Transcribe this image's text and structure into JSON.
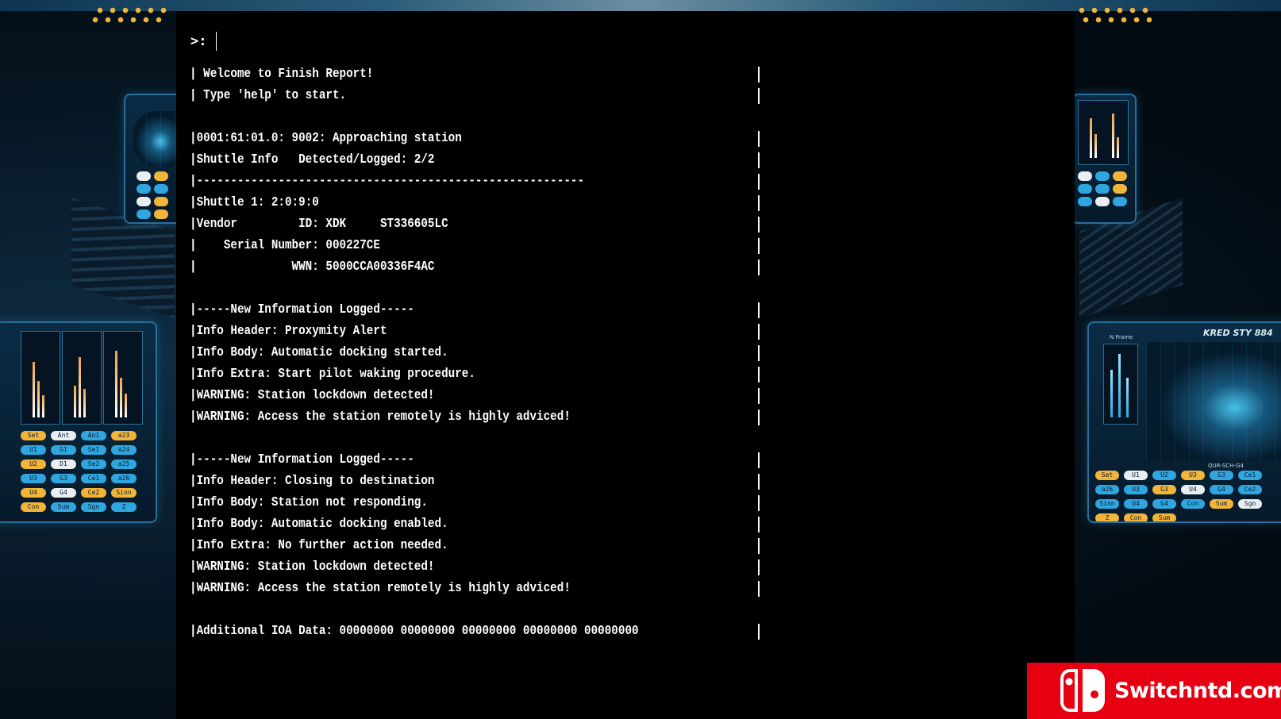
{
  "terminal": {
    "prompt": ">:",
    "lines": [
      "| Welcome to Finish Report!",
      "| Type 'help' to start.",
      "",
      "|0001:61:01.0: 9002: Approaching station",
      "|Shuttle Info   Detected/Logged: 2/2",
      "|---------------------------------------------------------",
      "|Shuttle 1: 2:0:9:0",
      "|Vendor         ID: XDK     ST336605LC",
      "|    Serial Number: 000227CE",
      "|              WWN: 5000CCA00336F4AC",
      "",
      "|-----New Information Logged-----",
      "|Info Header: Proxymity Alert",
      "|Info Body: Automatic docking started.",
      "|Info Extra: Start pilot waking procedure.",
      "|WARNING: Station lockdown detected!",
      "|WARNING: Access the station remotely is highly adviced!",
      "",
      "|-----New Information Logged-----",
      "|Info Header: Closing to destination",
      "|Info Body: Station not responding.",
      "|Info Body: Automatic docking enabled.",
      "|Info Extra: No further action needed.",
      "|WARNING: Station lockdown detected!",
      "|WARNING: Access the station remotely is highly adviced!",
      "",
      "|Additional IOA Data: 00000000 00000000 00000000 00000000 00000000"
    ]
  },
  "background_panels": {
    "right_panel_title": "KRED STY 884",
    "right_panel_label": "N Frame",
    "right_panel_sub": "QUR-SCH-G4",
    "left_chips": [
      "Set",
      "Ant",
      "An1",
      "a23",
      "U1",
      "G1",
      "Se1",
      "a24",
      "U2",
      "D1",
      "Se2",
      "a25",
      "U3",
      "G3",
      "Ce1",
      "a26",
      "U4",
      "G4",
      "Ce2",
      "Sinn",
      "Con",
      "Sum",
      "Sgn",
      "Z"
    ],
    "right_chips": [
      "Set",
      "U1",
      "U2",
      "U3",
      "G3",
      "Ce1",
      "a26",
      "U3",
      "G3",
      "U4",
      "G4",
      "Ce2",
      "Sinn",
      "U4",
      "G4",
      "Con",
      "Sum",
      "Sgn",
      "Z",
      "Con",
      "Sum"
    ]
  },
  "watermark": {
    "text": "Switchntd.com",
    "icon": "nintendo-switch-logo-icon"
  },
  "colors": {
    "terminal_bg": "#000000",
    "terminal_fg": "#ffffff",
    "hud_blue": "#2fa6e0",
    "hud_yellow": "#f2b53a",
    "watermark_red": "#e60012"
  }
}
